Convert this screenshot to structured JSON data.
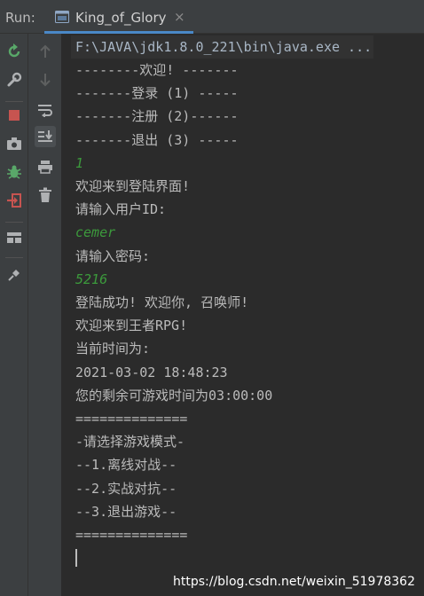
{
  "run_panel": {
    "label": "Run:",
    "tab": {
      "title": "King_of_Glory",
      "close": "×"
    }
  },
  "console": {
    "command_line": "F:\\JAVA\\jdk1.8.0_221\\bin\\java.exe ...",
    "lines": [
      {
        "text": "--------欢迎! -------",
        "kind": "output"
      },
      {
        "text": "-------登录 (1) -----",
        "kind": "output"
      },
      {
        "text": "-------注册 (2)------",
        "kind": "output"
      },
      {
        "text": "-------退出 (3) -----",
        "kind": "output"
      },
      {
        "text": "1",
        "kind": "input"
      },
      {
        "text": "欢迎来到登陆界面!",
        "kind": "output"
      },
      {
        "text": "请输入用户ID:",
        "kind": "output"
      },
      {
        "text": "cemer",
        "kind": "input"
      },
      {
        "text": "请输入密码:",
        "kind": "output"
      },
      {
        "text": "5216",
        "kind": "input"
      },
      {
        "text": "登陆成功! 欢迎你, 召唤师!",
        "kind": "output"
      },
      {
        "text": "欢迎来到王者RPG!",
        "kind": "output"
      },
      {
        "text": "当前时间为:",
        "kind": "output"
      },
      {
        "text": "2021-03-02 18:48:23",
        "kind": "output"
      },
      {
        "text": "您的剩余可游戏时间为03:00:00",
        "kind": "output"
      },
      {
        "text": "==============",
        "kind": "output"
      },
      {
        "text": "-请选择游戏模式-",
        "kind": "output"
      },
      {
        "text": "--1.离线对战--",
        "kind": "output"
      },
      {
        "text": "--2.实战对抗--",
        "kind": "output"
      },
      {
        "text": "--3.退出游戏--",
        "kind": "output"
      },
      {
        "text": "==============",
        "kind": "output"
      }
    ]
  },
  "watermark": "https://blog.csdn.net/weixin_51978362",
  "colors": {
    "background": "#2b2b2b",
    "toolbar": "#3c3f41",
    "text": "#bbbbbb",
    "user_input": "#3c9a3c",
    "tab_underline": "#4a88c7"
  },
  "icons": {
    "left_toolbar": [
      "rerun-icon",
      "wrench-icon",
      "stop-icon",
      "camera-icon",
      "debug-bug-icon",
      "exit-icon",
      "layout-icon",
      "pin-icon"
    ],
    "second_toolbar": [
      "up-arrow-icon",
      "down-arrow-icon",
      "soft-wrap-icon",
      "scroll-to-end-icon",
      "print-icon",
      "trash-icon"
    ]
  }
}
